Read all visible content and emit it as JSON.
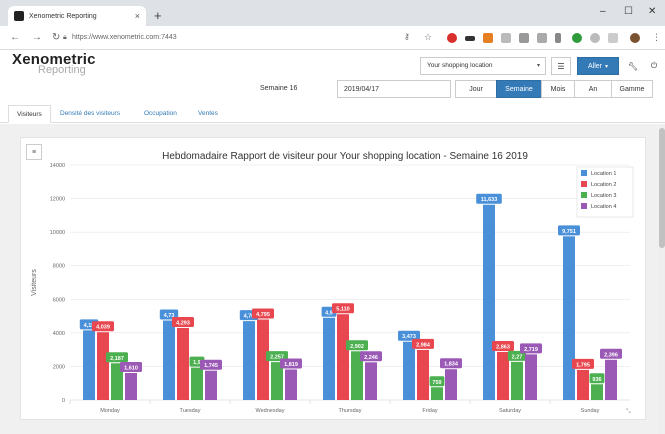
{
  "browser": {
    "tab_title": "Xenometric Reporting",
    "tab_close": "×",
    "new_tab": "+",
    "url": "https://www.xenometric.com:7443",
    "win_minimize": "–",
    "win_maximize": "☐",
    "win_close": "✕"
  },
  "header": {
    "logo_main": "Xenometric",
    "logo_sub": "Reporting",
    "location_select": "Your shopping location",
    "aller_label": "Aller",
    "week_label": "Semaine 16",
    "date_value": "2019/04/17",
    "periods": [
      {
        "label": "Jour",
        "active": false
      },
      {
        "label": "Semaine",
        "active": true
      },
      {
        "label": "Mois",
        "active": false
      },
      {
        "label": "An",
        "active": false
      },
      {
        "label": "Gamme",
        "active": false
      }
    ]
  },
  "nav_tabs": [
    "Visiteurs",
    "Densité des visiteurs",
    "Occupation",
    "Ventes"
  ],
  "chart_data": {
    "type": "bar",
    "title": "Hebdomadaire Rapport de visiteur pour Your shopping location - Semaine 16 2019",
    "xlabel": "",
    "ylabel": "Visiteurs",
    "ylim": [
      0,
      14000
    ],
    "yticks": [
      0,
      2000,
      4000,
      6000,
      8000,
      10000,
      12000,
      14000
    ],
    "categories": [
      "Monday",
      "Tuesday",
      "Wednesday",
      "Thursday",
      "Friday",
      "Saturday",
      "Sunday"
    ],
    "legend_position": "top-right",
    "series": [
      {
        "name": "Location 1",
        "color": "#4a90d9",
        "values": [
          4150,
          4735,
          4700,
          4900,
          3473,
          11633,
          9751
        ],
        "labels": [
          "4,15",
          "4,73",
          "4,70",
          "4,9",
          "3,473",
          "11,633",
          "9,751"
        ]
      },
      {
        "name": "Location 2",
        "color": "#e8474f",
        "values": [
          4039,
          4293,
          4795,
          5110,
          2984,
          2863,
          1795
        ],
        "labels": [
          "4,039",
          "4,293",
          "4,795",
          "5,110",
          "2,984",
          "2,863",
          "1,795"
        ]
      },
      {
        "name": "Location 3",
        "color": "#4caf50",
        "values": [
          2187,
          1930,
          2257,
          2902,
          759,
          2271,
          936
        ],
        "labels": [
          "2,187",
          "1,9",
          "2,257",
          "2,902",
          "759",
          "2,27",
          "936"
        ]
      },
      {
        "name": "Location 4",
        "color": "#9b59b6",
        "values": [
          1610,
          1745,
          1819,
          2246,
          1834,
          2719,
          2396
        ],
        "labels": [
          "1,610",
          "1,745",
          "1,819",
          "2,246",
          "1,834",
          "2,719",
          "2,396"
        ]
      }
    ]
  }
}
